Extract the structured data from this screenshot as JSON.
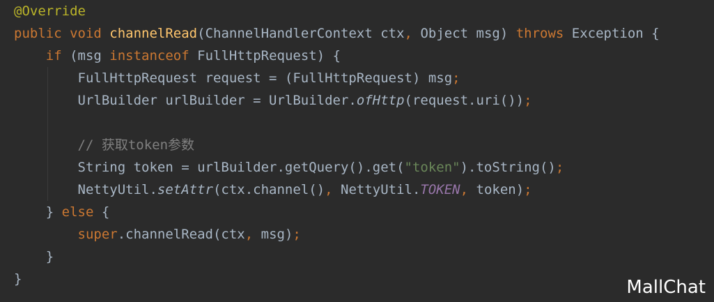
{
  "editor": {
    "theme_colors": {
      "background": "#2b2b2b",
      "keyword": "#cc7832",
      "method": "#ffc66d",
      "string": "#6a8759",
      "comment": "#808080",
      "constant": "#9876aa",
      "annotation": "#bbb529",
      "text": "#a9b7c6"
    },
    "lines": [
      [
        {
          "t": "ann",
          "v": "@Override"
        }
      ],
      [
        {
          "t": "kw",
          "v": "public "
        },
        {
          "t": "kw",
          "v": "void "
        },
        {
          "t": "fn",
          "v": "channelRead"
        },
        {
          "t": "plain",
          "v": "(ChannelHandlerContext ctx"
        },
        {
          "t": "kw",
          "v": ", "
        },
        {
          "t": "plain",
          "v": "Object msg) "
        },
        {
          "t": "kw",
          "v": "throws "
        },
        {
          "t": "plain",
          "v": "Exception {"
        }
      ],
      [
        {
          "t": "plain",
          "v": "    "
        },
        {
          "t": "kw",
          "v": "if "
        },
        {
          "t": "plain",
          "v": "(msg "
        },
        {
          "t": "kw",
          "v": "instanceof "
        },
        {
          "t": "plain",
          "v": "FullHttpRequest) {"
        }
      ],
      [
        {
          "t": "plain",
          "v": "        FullHttpRequest request = (FullHttpRequest) msg"
        },
        {
          "t": "kw",
          "v": ";"
        }
      ],
      [
        {
          "t": "plain",
          "v": "        UrlBuilder urlBuilder = UrlBuilder."
        },
        {
          "t": "ital",
          "v": "ofHttp"
        },
        {
          "t": "plain",
          "v": "(request.uri())"
        },
        {
          "t": "kw",
          "v": ";"
        }
      ],
      [
        {
          "t": "plain",
          "v": ""
        }
      ],
      [
        {
          "t": "plain",
          "v": "        "
        },
        {
          "t": "cmt",
          "v": "// 获取token参数"
        }
      ],
      [
        {
          "t": "plain",
          "v": "        String token = urlBuilder.getQuery().get("
        },
        {
          "t": "str",
          "v": "\"token\""
        },
        {
          "t": "plain",
          "v": ").toString()"
        },
        {
          "t": "kw",
          "v": ";"
        }
      ],
      [
        {
          "t": "plain",
          "v": "        NettyUtil."
        },
        {
          "t": "ital",
          "v": "setAttr"
        },
        {
          "t": "plain",
          "v": "(ctx.channel()"
        },
        {
          "t": "kw",
          "v": ", "
        },
        {
          "t": "plain",
          "v": "NettyUtil."
        },
        {
          "t": "const",
          "v": "TOKEN"
        },
        {
          "t": "kw",
          "v": ", "
        },
        {
          "t": "plain",
          "v": "token)"
        },
        {
          "t": "kw",
          "v": ";"
        }
      ],
      [
        {
          "t": "plain",
          "v": "    } "
        },
        {
          "t": "kw",
          "v": "else "
        },
        {
          "t": "plain",
          "v": "{"
        }
      ],
      [
        {
          "t": "plain",
          "v": "        "
        },
        {
          "t": "kw",
          "v": "super"
        },
        {
          "t": "plain",
          "v": ".channelRead(ctx"
        },
        {
          "t": "kw",
          "v": ", "
        },
        {
          "t": "plain",
          "v": "msg)"
        },
        {
          "t": "kw",
          "v": ";"
        }
      ],
      [
        {
          "t": "plain",
          "v": "    }"
        }
      ],
      [
        {
          "t": "plain",
          "v": "}"
        }
      ]
    ]
  },
  "watermark": "MallChat"
}
